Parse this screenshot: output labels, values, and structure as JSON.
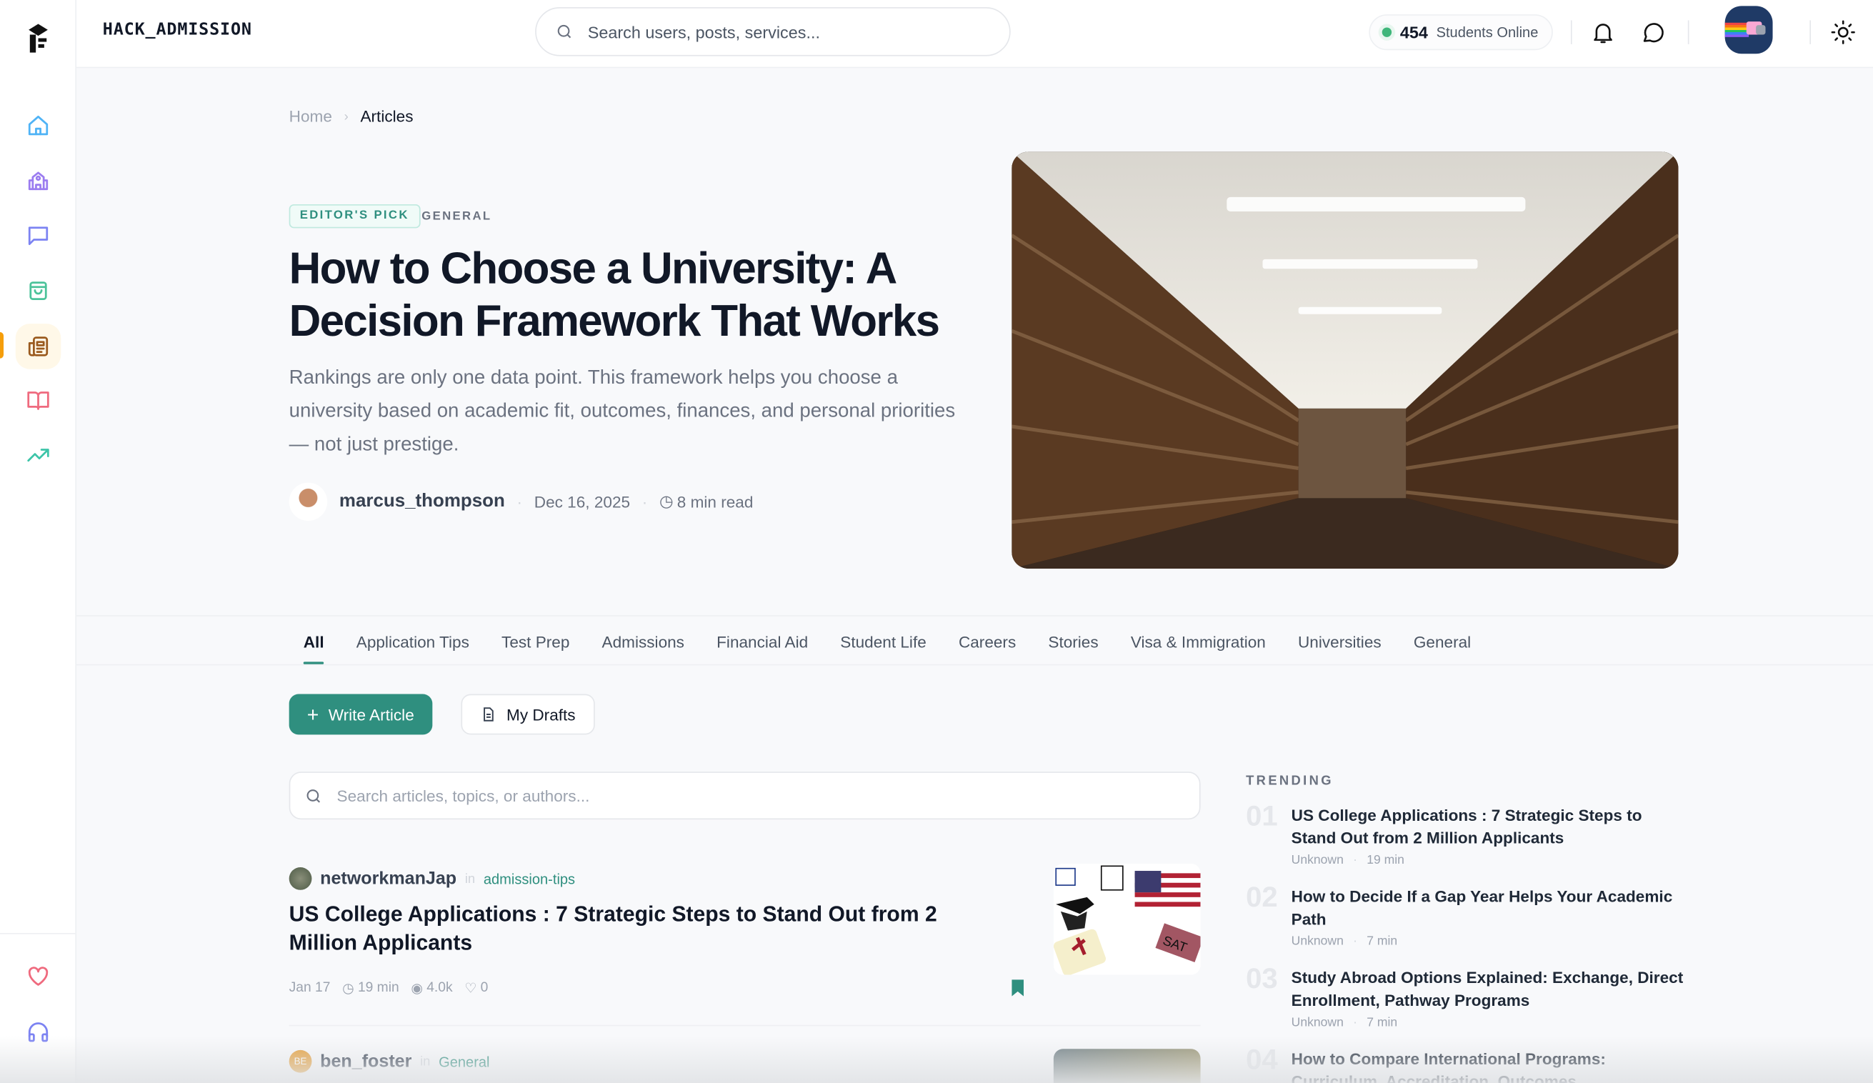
{
  "brand": {
    "name": "HACK_ADMISSION"
  },
  "header": {
    "search_placeholder": "Search users, posts, services...",
    "online_count": "454",
    "online_label": "Students Online"
  },
  "sidebar": {
    "items": [
      {
        "name": "home",
        "color": "#4fb3f6"
      },
      {
        "name": "university",
        "color": "#9b7cf0"
      },
      {
        "name": "messages",
        "color": "#7c83f2"
      },
      {
        "name": "shop",
        "color": "#4cc39a"
      },
      {
        "name": "articles",
        "color": "#9a5a1e",
        "active": true
      },
      {
        "name": "library",
        "color": "#ef6a7e"
      },
      {
        "name": "trending",
        "color": "#3cc4a8"
      }
    ],
    "bottom": [
      {
        "name": "favorites",
        "color": "#ef6a7e"
      },
      {
        "name": "support",
        "color": "#7c83f2"
      }
    ]
  },
  "breadcrumb": {
    "home": "Home",
    "current": "Articles"
  },
  "featured": {
    "badge": "EDITOR'S PICK",
    "category": "GENERAL",
    "title": "How to Choose a University: A Decision Framework That Works",
    "description": "Rankings are only one data point. This framework helps you choose a university based on academic fit, outcomes, finances, and personal priorities — not just prestige.",
    "author": "marcus_thompson",
    "date": "Dec 16, 2025",
    "read_time": "8 min read"
  },
  "tabs": [
    "All",
    "Application Tips",
    "Test Prep",
    "Admissions",
    "Financial Aid",
    "Student Life",
    "Careers",
    "Stories",
    "Visa & Immigration",
    "Universities",
    "General"
  ],
  "actions": {
    "write": "Write Article",
    "drafts": "My Drafts"
  },
  "article_search": {
    "placeholder": "Search articles, topics, or authors..."
  },
  "articles": [
    {
      "author": "networkmanJap",
      "in": "in",
      "category": "admission-tips",
      "title": "US College Applications : 7 Strategic Steps to Stand Out from 2 Million Applicants",
      "date": "Jan 17",
      "read": "19 min",
      "views": "4.0k",
      "likes": "0"
    },
    {
      "author": "ben_foster",
      "initials": "BE",
      "in": "in",
      "category": "General"
    }
  ],
  "trending": {
    "heading": "TRENDING",
    "items": [
      {
        "num": "01",
        "title": "US College Applications : 7 Strategic Steps to Stand Out from 2 Million Applicants",
        "author": "Unknown",
        "time": "19 min"
      },
      {
        "num": "02",
        "title": "How to Decide If a Gap Year Helps Your Academic Path",
        "author": "Unknown",
        "time": "7 min"
      },
      {
        "num": "03",
        "title": "Study Abroad Options Explained: Exchange, Direct Enrollment, Pathway Programs",
        "author": "Unknown",
        "time": "7 min"
      },
      {
        "num": "04",
        "title": "How to Compare International Programs: Curriculum, Accreditation, Outcomes",
        "author": "",
        "time": ""
      }
    ]
  }
}
